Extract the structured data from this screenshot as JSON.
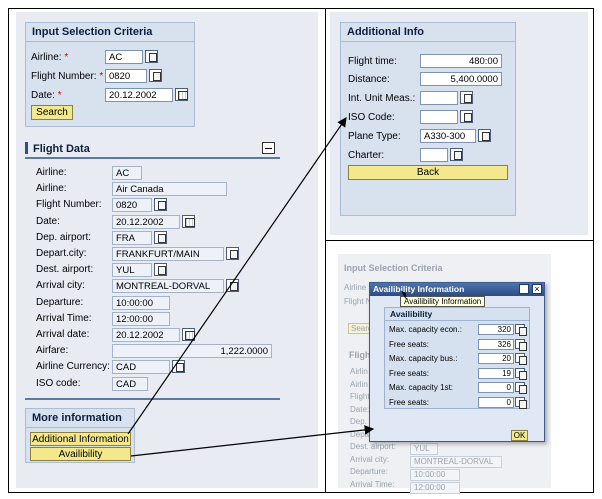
{
  "input_criteria": {
    "title": "Input Selection Criteria",
    "airline_label": "Airline:",
    "airline_value": "AC",
    "flight_number_label": "Flight Number:",
    "flight_number_value": "0820",
    "date_label": "Date:",
    "date_value": "20.12.2002",
    "required_mark": "*",
    "search_button": "Search"
  },
  "flight_data": {
    "title": "Flight Data",
    "rows": [
      {
        "label": "Airline:",
        "value": "AC"
      },
      {
        "label": "Airline:",
        "value": "Air Canada"
      },
      {
        "label": "Flight Number:",
        "value": "0820"
      },
      {
        "label": "Date:",
        "value": "20.12.2002"
      },
      {
        "label": "Dep. airport:",
        "value": "FRA"
      },
      {
        "label": "Depart.city:",
        "value": "FRANKFURT/MAIN"
      },
      {
        "label": "Dest. airport:",
        "value": "YUL"
      },
      {
        "label": "Arrival city:",
        "value": "MONTREAL-DORVAL"
      },
      {
        "label": "Departure:",
        "value": "10:00:00"
      },
      {
        "label": "Arrival Time:",
        "value": "12:00:00"
      },
      {
        "label": "Arrival date:",
        "value": "20.12.2002"
      },
      {
        "label": "Airfare:",
        "value": "1,222.0000"
      },
      {
        "label": "Airline Currency:",
        "value": "CAD"
      },
      {
        "label": "ISO code:",
        "value": "CAD"
      }
    ]
  },
  "more_info": {
    "title": "More information",
    "additional_button": "Additional Information",
    "availability_button": "Availibility"
  },
  "additional_info": {
    "title": "Additional Info",
    "flight_time_label": "Flight time:",
    "flight_time_value": "480:00",
    "distance_label": "Distance:",
    "distance_value": "5,400.0000",
    "unit_label": "Int. Unit Meas.:",
    "unit_value": "",
    "iso_label": "ISO Code:",
    "iso_value": "",
    "plane_label": "Plane Type:",
    "plane_value": "A330-300",
    "charter_label": "Charter:",
    "charter_value": "",
    "back_button": "Back"
  },
  "availability_popup": {
    "window_title": "Availibility Information",
    "tooltip": "Availibility Information",
    "group_title": "Availibility",
    "rows": [
      {
        "label": "Max. capacity econ.:",
        "value": "320"
      },
      {
        "label": "Free seats:",
        "value": "326"
      },
      {
        "label": "Max. capacity bus.:",
        "value": "20"
      },
      {
        "label": "Free seats:",
        "value": "19"
      },
      {
        "label": "Max. capacity 1st:",
        "value": "0"
      },
      {
        "label": "Free seats:",
        "value": "0"
      }
    ],
    "ok_button": "OK"
  },
  "background_screen": {
    "input_title": "Input Selection Criteria",
    "airline_short": "Airline",
    "flight_short": "Flight N",
    "search_short": "Searc",
    "flight_short_title": "Fligh",
    "rows": [
      "Airlin",
      "Airlin",
      "Flight",
      "Date:",
      "Dep.",
      "Depa",
      "Dest. airport:",
      "Arrival city:",
      "Departure:",
      "Arrival Time:"
    ],
    "dest_value": "YUL",
    "arrival_city_value": "MONTREAL-DORVAL",
    "departure_value": "10:00:00",
    "arrival_time_value": "12:00:00"
  }
}
